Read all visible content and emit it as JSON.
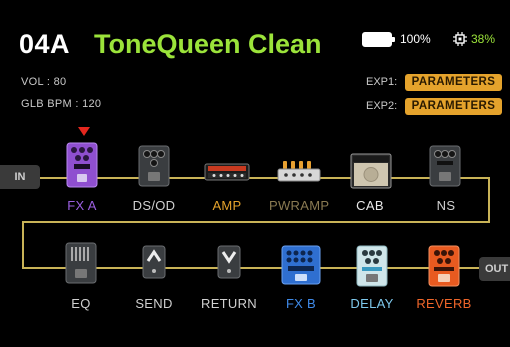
{
  "header": {
    "preset_number": "04A",
    "preset_name": "ToneQueen Clean",
    "battery_pct": "100%",
    "cpu_pct": "38%"
  },
  "info": {
    "vol": "VOL : 80",
    "bpm": "GLB BPM : 120"
  },
  "expression": {
    "exp1_label": "EXP1:",
    "exp1_button": "PARAMETERS",
    "exp2_label": "EXP2:",
    "exp2_button": "PARAMETERS"
  },
  "chain": {
    "in_label": "IN",
    "out_label": "OUT",
    "row1": [
      {
        "label": "FX A",
        "color": "#9b5fe0",
        "icon": "fx-pedal-icon"
      },
      {
        "label": "DS/OD",
        "color": "#d0d0d0",
        "icon": "drive-pedal-icon"
      },
      {
        "label": "AMP",
        "color": "#e5a32c",
        "icon": "amp-head-icon"
      },
      {
        "label": "PWRAMP",
        "color": "#8a7a52",
        "icon": "power-amp-icon"
      },
      {
        "label": "CAB",
        "color": "#e8e8e8",
        "icon": "cabinet-icon"
      },
      {
        "label": "NS",
        "color": "#d0d0d0",
        "icon": "noise-gate-icon"
      }
    ],
    "row2": [
      {
        "label": "EQ",
        "color": "#d0d0d0",
        "icon": "eq-pedal-icon"
      },
      {
        "label": "SEND",
        "color": "#d0d0d0",
        "icon": "send-icon"
      },
      {
        "label": "RETURN",
        "color": "#d0d0d0",
        "icon": "return-icon"
      },
      {
        "label": "FX B",
        "color": "#3f8ae8",
        "icon": "fx-b-pedal-icon"
      },
      {
        "label": "DELAY",
        "color": "#7ec8ec",
        "icon": "delay-pedal-icon"
      },
      {
        "label": "REVERB",
        "color": "#f0662a",
        "icon": "reverb-pedal-icon"
      }
    ]
  },
  "colors": {
    "accent_green": "#9be33a",
    "accent_orange": "#e5a32c",
    "chain_line": "#c9b357",
    "selected_marker": "#e5271e"
  }
}
